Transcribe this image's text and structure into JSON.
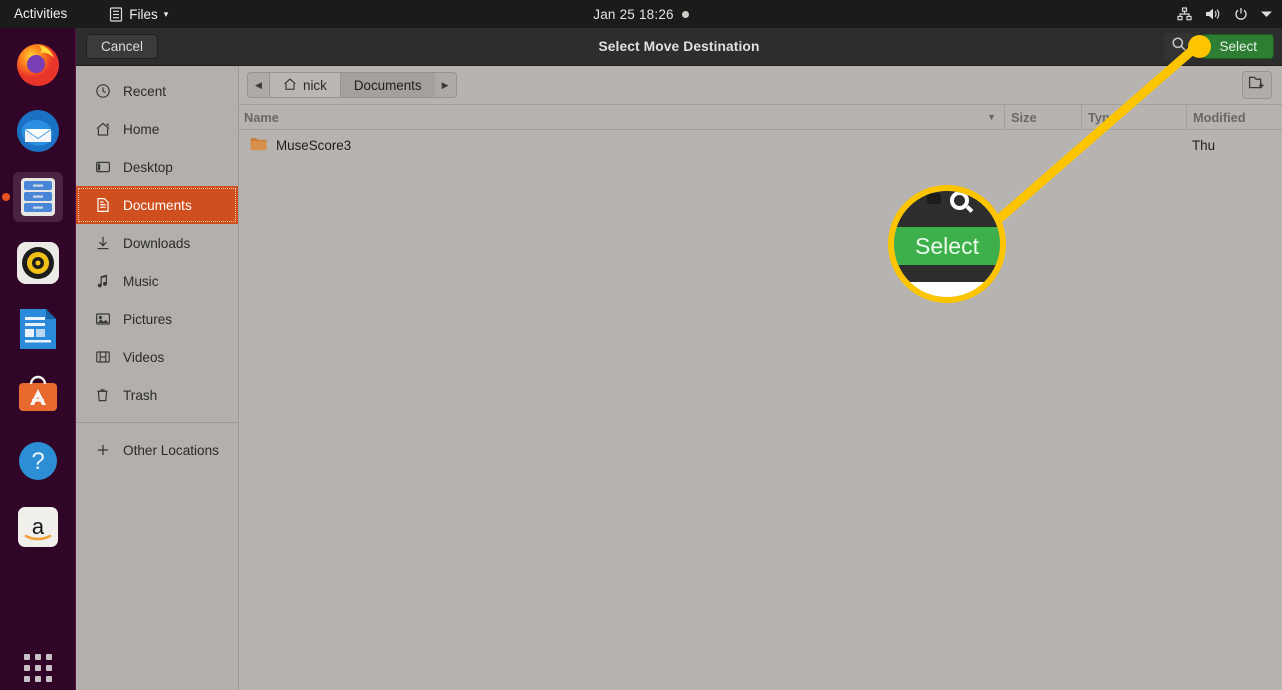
{
  "topbar": {
    "activities": "Activities",
    "app_menu": {
      "label": "Files",
      "icon": "files-icon",
      "caret": "▾"
    },
    "clock": "Jan 25  18:26",
    "indicator": "recording-dot",
    "tray_icons": [
      "network-icon",
      "volume-icon",
      "power-icon",
      "chevron-down-icon"
    ]
  },
  "dock": {
    "items": [
      {
        "name": "firefox",
        "label": "Firefox",
        "active": false
      },
      {
        "name": "thunderbird",
        "label": "Thunderbird",
        "active": false
      },
      {
        "name": "files",
        "label": "Files",
        "active": true
      },
      {
        "name": "rhythmbox",
        "label": "Rhythmbox",
        "active": false
      },
      {
        "name": "libreoffice-writer",
        "label": "LibreOffice Writer",
        "active": false
      },
      {
        "name": "ubuntu-software",
        "label": "Ubuntu Software",
        "active": false
      },
      {
        "name": "help",
        "label": "Help",
        "active": false
      },
      {
        "name": "amazon",
        "label": "Amazon",
        "active": false
      }
    ],
    "show_apps_label": "Show Applications"
  },
  "dialog": {
    "title": "Select Move Destination",
    "cancel_label": "Cancel",
    "select_label": "Select",
    "search_icon": "search-icon",
    "new_folder_icon": "new-folder-icon"
  },
  "sidebar": {
    "items": [
      {
        "label": "Recent",
        "icon": "clock-icon",
        "selected": false
      },
      {
        "label": "Home",
        "icon": "home-icon",
        "selected": false
      },
      {
        "label": "Desktop",
        "icon": "desktop-icon",
        "selected": false
      },
      {
        "label": "Documents",
        "icon": "document-icon",
        "selected": true
      },
      {
        "label": "Downloads",
        "icon": "download-icon",
        "selected": false
      },
      {
        "label": "Music",
        "icon": "music-note-icon",
        "selected": false
      },
      {
        "label": "Pictures",
        "icon": "image-icon",
        "selected": false
      },
      {
        "label": "Videos",
        "icon": "film-icon",
        "selected": false
      },
      {
        "label": "Trash",
        "icon": "trash-icon",
        "selected": false
      }
    ],
    "other_locations": {
      "label": "Other Locations",
      "icon": "plus-icon"
    }
  },
  "pathbar": {
    "back_arrow": "◀",
    "forward_arrow": "▶",
    "crumbs": [
      {
        "label": "nick",
        "icon": "home-icon",
        "active": false
      },
      {
        "label": "Documents",
        "icon": null,
        "active": true
      }
    ]
  },
  "columns": {
    "name": "Name",
    "size": "Size",
    "type": "Type",
    "modified": "Modified",
    "sort_caret": "▼"
  },
  "files": [
    {
      "name": "MuseScore3",
      "icon": "folder-icon",
      "size": "",
      "type": "",
      "modified": "Thu"
    }
  ],
  "annotation": {
    "magnified_label": "Select",
    "callout_color": "#fdc500",
    "accent_green": "#2d7d32",
    "magnified_green": "#3eb04b",
    "selected_item_color": "#cf4f1f"
  }
}
